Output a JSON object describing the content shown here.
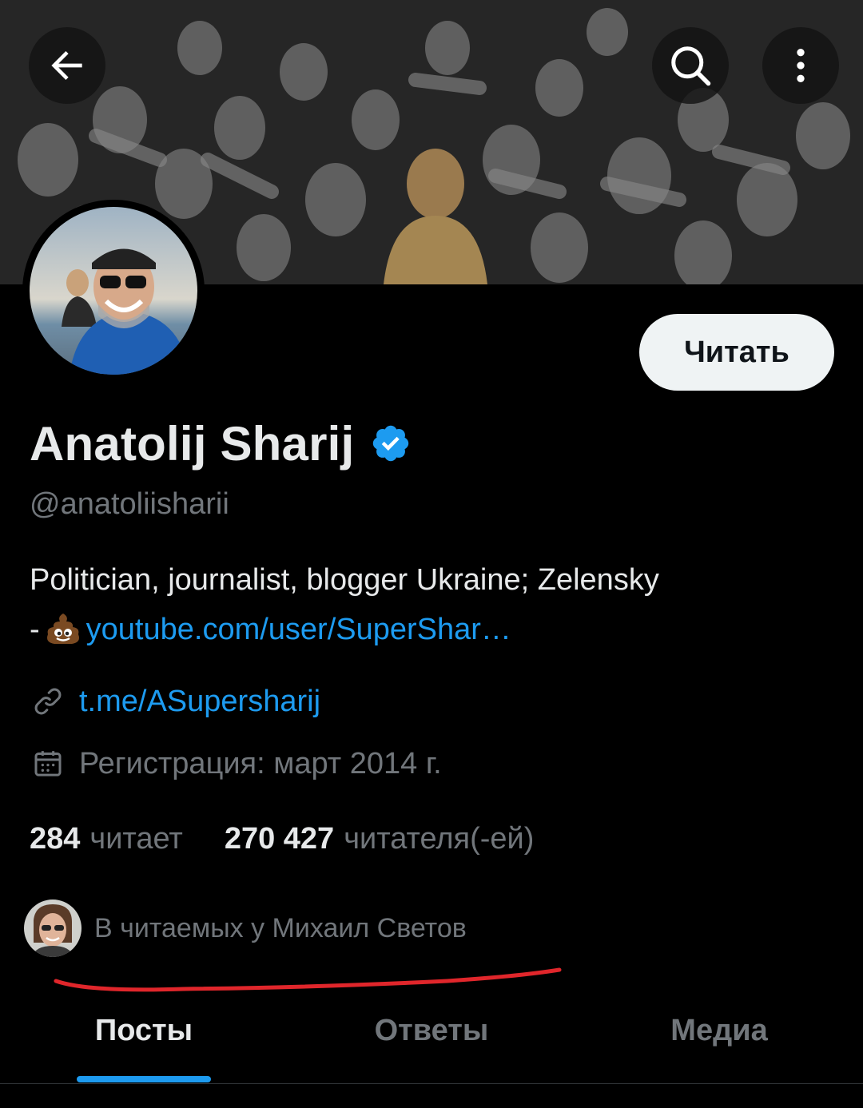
{
  "header": {
    "back_icon": "arrow-left-icon",
    "search_icon": "search-icon",
    "more_icon": "more-vertical-icon"
  },
  "profile": {
    "follow_label": "Читать",
    "name": "Anatolij Sharij",
    "verified_icon": "verified-badge-icon",
    "handle": "@anatoliisharii",
    "bio": {
      "line1": "Politician, journalist, blogger Ukraine; Zelensky",
      "line2_prefix": "-",
      "emoji": "pile-of-poo",
      "link": "youtube.com/user/SuperShar…"
    },
    "website": "t.me/ASupersharij",
    "joined": "Регистрация: март 2014 г.",
    "following_count": "284",
    "following_label": "читает",
    "followers_count": "270 427",
    "followers_label": "читателя(-ей)",
    "followed_by": "В читаемых у Михаил Светов"
  },
  "tabs": [
    {
      "label": "Посты",
      "active": true
    },
    {
      "label": "Ответы",
      "active": false
    },
    {
      "label": "Медиа",
      "active": false
    }
  ],
  "colors": {
    "background": "#000000",
    "text_primary": "#e7e9ea",
    "text_secondary": "#71767b",
    "accent": "#1d9bf0",
    "annotation_underline": "#e0262b"
  }
}
